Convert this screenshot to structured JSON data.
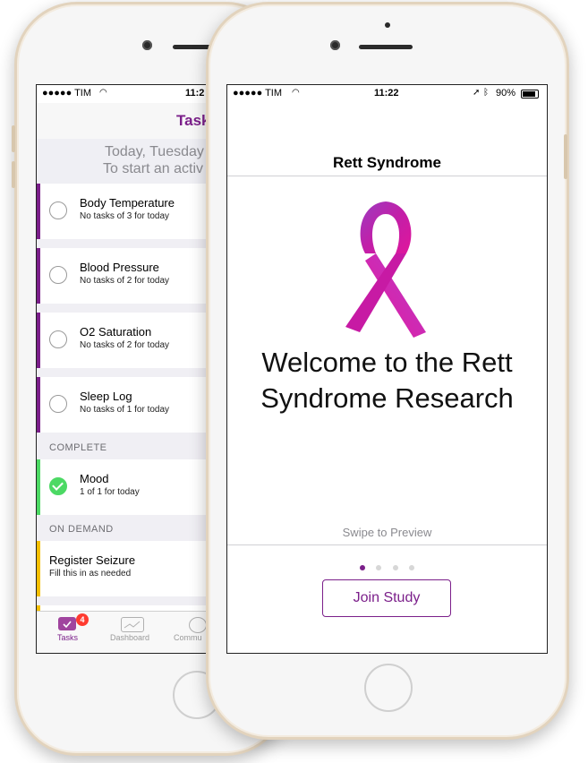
{
  "back_phone": {
    "status": {
      "carrier": "●●●●● TIM",
      "time": "11:2"
    },
    "nav_title": "Task",
    "header_line1": "Today, Tuesday",
    "header_line2": "To start an activ",
    "tasks": [
      {
        "title": "Body Temperature",
        "subtitle": "No tasks of 3 for today"
      },
      {
        "title": "Blood Pressure",
        "subtitle": "No tasks of 2 for today"
      },
      {
        "title": "O2 Saturation",
        "subtitle": "No tasks of 2 for today"
      },
      {
        "title": "Sleep Log",
        "subtitle": "No tasks of 1 for today"
      }
    ],
    "complete_header": "COMPLETE",
    "complete_task": {
      "title": "Mood",
      "subtitle": "1 of 1 for today"
    },
    "on_demand_header": "ON DEMAND",
    "on_demand_task": {
      "title": "Register Seizure",
      "subtitle": "Fill this in as needed"
    },
    "tabbar": {
      "tasks_label": "Tasks",
      "tasks_badge": "4",
      "dashboard_label": "Dashboard",
      "community_label": "Commu"
    },
    "colors": {
      "purple_bar": "#7b1f8a",
      "green_bar": "#4cd964",
      "yellow_bar": "#f5c000"
    }
  },
  "front_phone": {
    "status": {
      "carrier": "●●●●● TIM",
      "time": "11:22",
      "battery": "90%"
    },
    "title": "Rett Syndrome",
    "welcome_line1": "Welcome to the Rett",
    "welcome_line2": "Syndrome Research",
    "swipe_text": "Swipe to Preview",
    "pager": {
      "count": 4,
      "active": 0
    },
    "join_button": "Join Study",
    "colors": {
      "accent": "#7b1f8a",
      "ribbon_pink": "#e0169c",
      "ribbon_purple": "#8e2fb4"
    }
  }
}
